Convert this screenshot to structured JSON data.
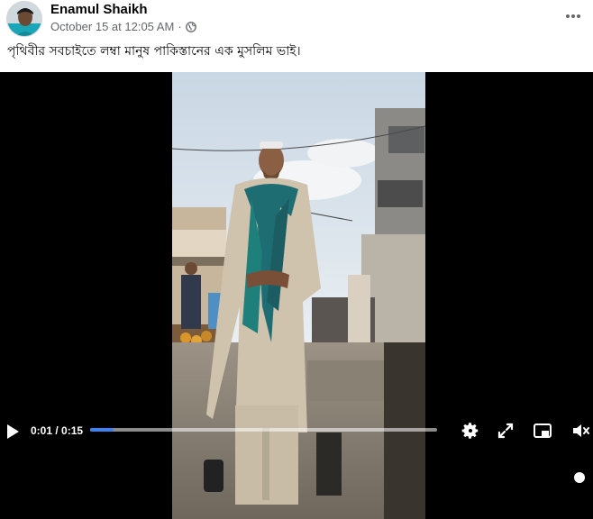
{
  "post": {
    "author": "Enamul Shaikh",
    "timestamp": "October 15 at 12:05 AM",
    "separator": "·",
    "audience_icon": "globe-icon",
    "more_icon": "more-dots-icon",
    "caption": "পৃথিবীর সবচাইতে লম্বা মানুষ পাকিস্তানের এক মুসলিম ভাই।"
  },
  "video": {
    "current_time": "0:01",
    "duration": "0:15",
    "time_separator": " / ",
    "progress": 0.067,
    "accent_color": "#3b82f6",
    "controls": {
      "play_icon": "play-icon",
      "settings_icon": "gear-icon",
      "fullscreen_icon": "fullscreen-icon",
      "pip_icon": "picture-in-picture-icon",
      "volume_icon": "volume-icon"
    }
  }
}
